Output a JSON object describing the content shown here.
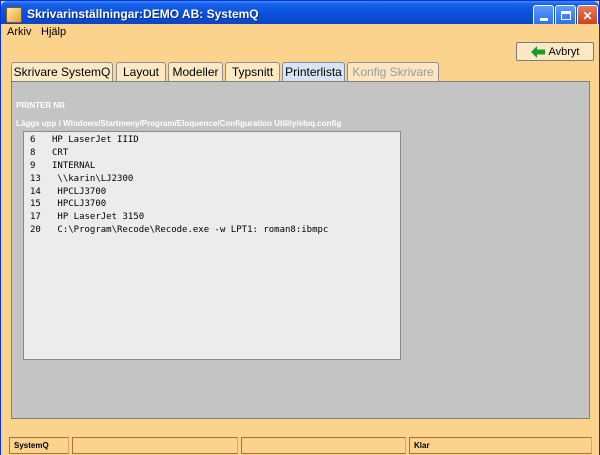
{
  "window": {
    "title": "Skrivarinställningar:DEMO AB: SystemQ"
  },
  "menu": {
    "items": [
      {
        "label": "Arkiv"
      },
      {
        "label": "Hjälp"
      }
    ]
  },
  "toolbar": {
    "cancel_label": "Avbryt",
    "cancel_icon": "arrow-left-icon",
    "cancel_icon_color": "#1a9a2a"
  },
  "tabs": [
    {
      "label": "Skrivare SystemQ",
      "state": "normal"
    },
    {
      "label": "Layout",
      "state": "normal"
    },
    {
      "label": "Modeller",
      "state": "normal"
    },
    {
      "label": "Typsnitt",
      "state": "normal"
    },
    {
      "label": "Printerlista",
      "state": "active"
    },
    {
      "label": "Konfig Skrivare",
      "state": "disabled"
    }
  ],
  "content": {
    "section_title": "PRINTER NR",
    "path_label": "Läggs upp i Windows/Startmeny/Program/Eloquence/Configuration Utility/eloq.config",
    "printers": [
      {
        "nr": "6",
        "name": "HP LaserJet IIID"
      },
      {
        "nr": "8",
        "name": "CRT"
      },
      {
        "nr": "9",
        "name": "INTERNAL"
      },
      {
        "nr": "13",
        "name": " \\\\karin\\LJ2300"
      },
      {
        "nr": "14",
        "name": " HPCLJ3700"
      },
      {
        "nr": "15",
        "name": " HPCLJ3700"
      },
      {
        "nr": "17",
        "name": " HP LaserJet 3150"
      },
      {
        "nr": "20",
        "name": " C:\\Program\\Recode\\Recode.exe -w LPT1: roman8:ibmpc"
      }
    ]
  },
  "statusbar": {
    "cells": [
      "SystemQ",
      "",
      "",
      "Klar"
    ]
  },
  "colors": {
    "titlebar": "#0a4fd8",
    "background": "#fbd38c",
    "panel": "#c4c4c4",
    "list": "#ececec"
  }
}
